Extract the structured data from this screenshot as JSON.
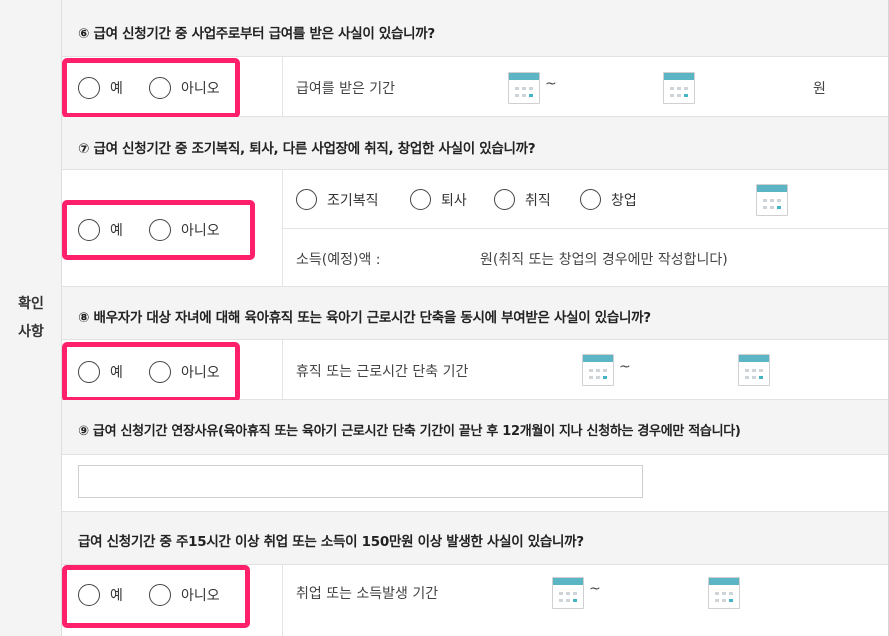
{
  "side_label_line1": "확인",
  "side_label_line2": "사항",
  "options": {
    "yes": "예",
    "no": "아니오"
  },
  "tilde": "~",
  "q6": {
    "text": "⑥ 급여 신청기간 중 사업주로부터 급여를 받은 사실이 있습니까?",
    "period_label": "급여를 받은 기간",
    "unit": "원"
  },
  "q7": {
    "text": "⑦ 급여 신청기간 중 조기복직, 퇴사, 다른 사업장에 취직, 창업한 사실이 있습니까?",
    "types": [
      "조기복직",
      "퇴사",
      "취직",
      "창업"
    ],
    "income_label": "소득(예정)액 :",
    "income_note": "원(취직 또는 창업의 경우에만 작성합니다)"
  },
  "q8": {
    "text": "⑧ 배우자가 대상 자녀에 대해 육아휴직 또는 육아기 근로시간 단축을 동시에 부여받은 사실이 있습니까?",
    "period_label": "휴직 또는 근로시간 단축 기간"
  },
  "q9": {
    "text": "⑨ 급여 신청기간 연장사유(육아휴직 또는 육아기 근로시간 단축 기간이 끝난 후 12개월이 지나 신청하는 경우에만 적습니다)",
    "input_value": ""
  },
  "q10": {
    "text": "급여 신청기간 중 주15시간 이상 취업 또는 소득이 150만원 이상 발생한 사실이 있습니까?",
    "period_label": "취업 또는 소득발생 기간"
  },
  "colors": {
    "highlight": "#ff1f6b",
    "calendar_accent": "#5bb5c5",
    "panel_bg": "#f4f4f4"
  },
  "icons": {
    "date_picker": "calendar-icon"
  }
}
